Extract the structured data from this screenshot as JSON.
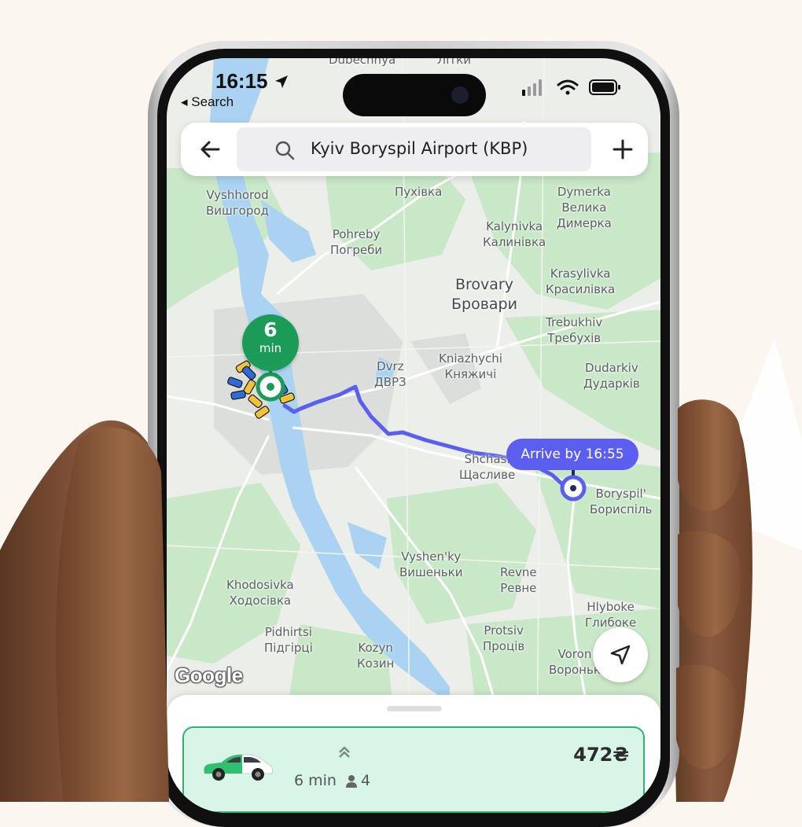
{
  "status_bar": {
    "time": "16:15",
    "back_label": "◂ Search"
  },
  "search": {
    "query": "Kyiv Boryspil Airport (KBP)",
    "icons": [
      "back-arrow-icon",
      "search-icon",
      "plus-icon"
    ]
  },
  "map": {
    "labels": [
      {
        "l1": "Vyshhorod",
        "l2": "Вишгород"
      },
      {
        "l1": "Pohreby",
        "l2": "Погреби"
      },
      {
        "l1": "Пухівка",
        "l2": ""
      },
      {
        "l1": "Dymerka",
        "l2": "Велика"
      },
      {
        "l1": "Димерка",
        "l2": ""
      },
      {
        "l1": "Kalynivka",
        "l2": "Калинівка"
      },
      {
        "l1": "Brovary",
        "l2": "Бровари"
      },
      {
        "l1": "Krasylivka",
        "l2": "Красилівка"
      },
      {
        "l1": "Trebukhiv",
        "l2": "Требухів"
      },
      {
        "l1": "Dvrz",
        "l2": "ДВРЗ"
      },
      {
        "l1": "Kniazhychi",
        "l2": "Княжичі"
      },
      {
        "l1": "Dudarkiv",
        "l2": "Дударків"
      },
      {
        "l1": "Shchasl",
        "l2": "Щасливе"
      },
      {
        "l1": "Boryspil'",
        "l2": "Бориспіль"
      },
      {
        "l1": "Vyshen'ky",
        "l2": "Вишеньки"
      },
      {
        "l1": "Revne",
        "l2": "Ревне"
      },
      {
        "l1": "Khodosivka",
        "l2": "Ходосівка"
      },
      {
        "l1": "Hlyboke",
        "l2": "Глибоке"
      },
      {
        "l1": "Pidhirtsi",
        "l2": "Підгірці"
      },
      {
        "l1": "Protsiv",
        "l2": "Проців"
      },
      {
        "l1": "Kozyn",
        "l2": "Козин"
      },
      {
        "l1": "Voron",
        "l2": "Вороньк"
      },
      {
        "l1": "Dubechnya",
        "l2": ""
      },
      {
        "l1": "Літки",
        "l2": ""
      }
    ],
    "pickup_eta": {
      "value": "6",
      "unit": "min"
    },
    "arrival": "Arrive by 16:55",
    "attribution": "Google",
    "colors": {
      "route": "#5b5ff0",
      "pickup": "#1a9b57",
      "water": "#a9d3f0",
      "green": "#c7e8c6"
    }
  },
  "ride_option": {
    "eta": "6 min",
    "seats": "4",
    "price": "472₴",
    "accent": "#2db46f"
  }
}
